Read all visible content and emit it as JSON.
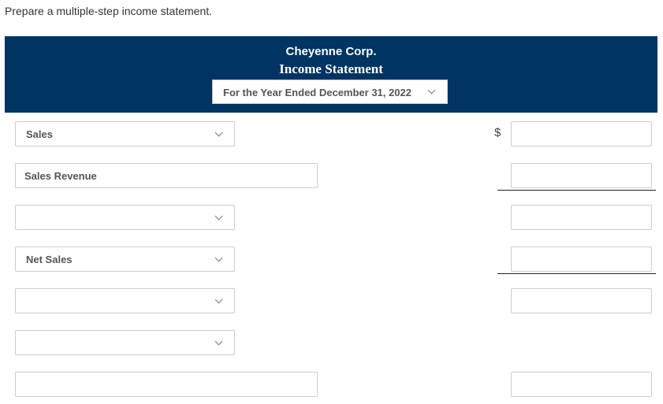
{
  "instruction": "Prepare a multiple-step income statement.",
  "header": {
    "company": "Cheyenne Corp.",
    "statement_title": "Income Statement",
    "period": "For the Year Ended December 31, 2022"
  },
  "currency_symbol": "$",
  "rows": [
    {
      "type": "select",
      "value": "Sales"
    },
    {
      "type": "text",
      "value": "Sales Revenue"
    },
    {
      "type": "select",
      "value": ""
    },
    {
      "type": "select",
      "value": "Net Sales"
    },
    {
      "type": "select",
      "value": ""
    },
    {
      "type": "select",
      "value": ""
    },
    {
      "type": "text",
      "value": ""
    }
  ],
  "amounts": [
    "",
    "",
    "",
    "",
    "",
    ""
  ]
}
